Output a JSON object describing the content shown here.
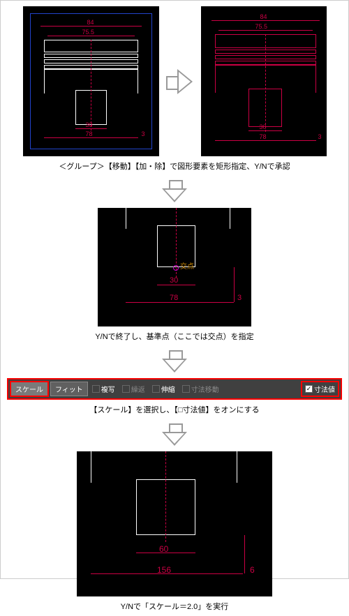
{
  "row1": {
    "dim_top1": "84",
    "dim_top2": "75.5",
    "dim_bot1": "30",
    "dim_bot2": "78",
    "dim_right": "3"
  },
  "caption1": "＜グループ＞【移動】【加・除】で図形要素を矩形指定、Y/Nで承認",
  "step2": {
    "dim_bot1": "30",
    "dim_bot2": "78",
    "dim_right": "3",
    "kouten": "交点"
  },
  "caption2": "Y/Nで終了し、基準点（ここでは交点）を指定",
  "toolbar": {
    "scale": "スケール",
    "fit": "フィット",
    "copy": "複写",
    "repeat": "繰返",
    "stretch": "伸縮",
    "dimmove": "寸法移動",
    "dimval": "寸法値"
  },
  "caption3": "【スケール】を選択し、【□寸法値】をオンにする",
  "step4": {
    "dim_bot1": "60",
    "dim_bot2": "156",
    "dim_right": "6"
  },
  "caption4": "Y/Nで「スケール＝2.0」を実行"
}
